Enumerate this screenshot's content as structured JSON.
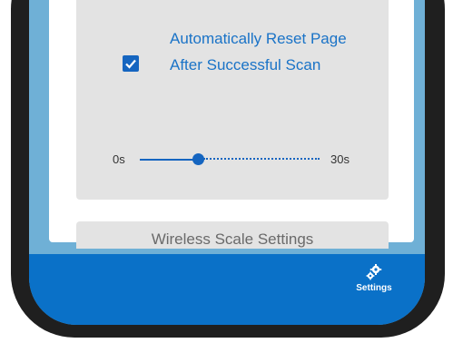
{
  "settings_card": {
    "auto_reset_checked": true,
    "auto_reset_label": "Automatically Reset Page After Successful Scan",
    "slider": {
      "min_label": "0s",
      "max_label": "30s",
      "min": 0,
      "max": 30,
      "value": 8
    }
  },
  "wireless_scale_card": {
    "title": "Wireless Scale Settings"
  },
  "bottom_nav": {
    "settings_label": "Settings",
    "settings_icon": "gears-icon"
  },
  "colors": {
    "accent": "#1565c0",
    "label_blue": "#1a73c7",
    "nav_bar": "#0a71c8",
    "card_bg": "#e3e3e3"
  }
}
